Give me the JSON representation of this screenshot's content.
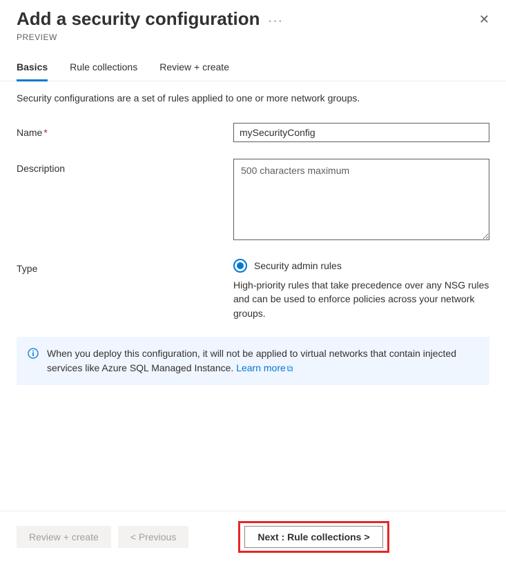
{
  "header": {
    "title": "Add a security configuration",
    "preview": "PREVIEW"
  },
  "tabs": [
    {
      "label": "Basics",
      "active": true
    },
    {
      "label": "Rule collections",
      "active": false
    },
    {
      "label": "Review + create",
      "active": false
    }
  ],
  "description": "Security configurations are a set of rules applied to one or more network groups.",
  "form": {
    "name": {
      "label": "Name",
      "value": "mySecurityConfig",
      "required": true
    },
    "description": {
      "label": "Description",
      "placeholder": "500 characters maximum"
    },
    "type": {
      "label": "Type",
      "option_label": "Security admin rules",
      "option_description": "High-priority rules that take precedence over any NSG rules and can be used to enforce policies across your network groups."
    }
  },
  "info": {
    "text": "When you deploy this configuration, it will not be applied to virtual networks that contain injected services like Azure SQL Managed Instance.  ",
    "link_text": "Learn more"
  },
  "footer": {
    "review_create": "Review + create",
    "previous": "< Previous",
    "next": "Next : Rule collections >"
  }
}
